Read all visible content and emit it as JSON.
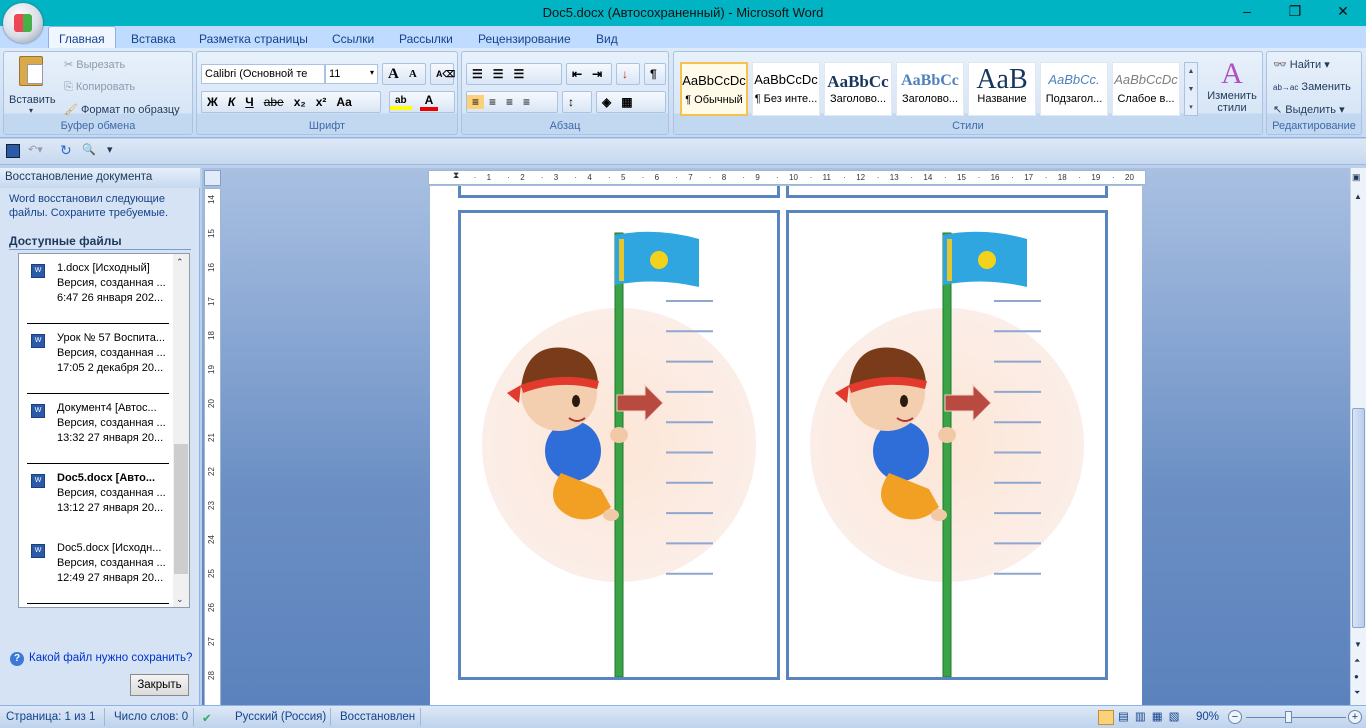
{
  "window": {
    "title": "Doc5.docx (Автосохраненный) - Microsoft Word",
    "min": "–",
    "max": "❐",
    "close": "✕"
  },
  "tabs": [
    "Главная",
    "Вставка",
    "Разметка страницы",
    "Ссылки",
    "Рассылки",
    "Рецензирование",
    "Вид"
  ],
  "clipboard": {
    "paste": "Вставить",
    "cut": "Вырезать",
    "copy": "Копировать",
    "format_painter": "Формат по образцу",
    "label": "Буфер обмена"
  },
  "font": {
    "name": "Calibri (Основной те",
    "size": "11",
    "label": "Шрифт",
    "bold": "Ж",
    "italic": "К",
    "underline": "Ч",
    "strike": "abe",
    "sub": "x₂",
    "sup": "x²",
    "case": "Aa",
    "grow": "A",
    "shrink": "A"
  },
  "paragraph": {
    "label": "Абзац",
    "pilcrow": "¶"
  },
  "styles": {
    "label": "Стили",
    "items": [
      {
        "sample": "AaBbCcDc",
        "name": "¶ Обычный"
      },
      {
        "sample": "AaBbCcDc",
        "name": "¶ Без инте..."
      },
      {
        "sample": "AaBbCc",
        "name": "Заголово..."
      },
      {
        "sample": "AaBbCc",
        "name": "Заголово..."
      },
      {
        "sample": "AaB",
        "name": "Название"
      },
      {
        "sample": "AaBbCc.",
        "name": "Подзагол..."
      },
      {
        "sample": "AaBbCcDc",
        "name": "Слабое в..."
      }
    ],
    "change": "Изменить стили"
  },
  "editing": {
    "label": "Редактирование",
    "find": "Найти",
    "replace": "Заменить",
    "select": "Выделить"
  },
  "recovery": {
    "title": "Восстановление документа",
    "message": "Word восстановил следующие файлы.  Сохраните требуемые.",
    "heading": "Доступные файлы",
    "files": [
      {
        "name": "1.docx  [Исходный]",
        "line2": "Версия, созданная ...",
        "line3": "6:47 26 января 202...",
        "bold": false
      },
      {
        "name": "Урок № 57 Воспита...",
        "line2": "Версия, созданная ...",
        "line3": "17:05 2 декабря 20...",
        "bold": false
      },
      {
        "name": "Документ4  [Автос...",
        "line2": "Версия, созданная ...",
        "line3": "13:32 27 января 20...",
        "bold": false
      },
      {
        "name": "Doc5.docx  [Авто...",
        "line2": "Версия, созданная ...",
        "line3": "13:12 27 января 20...",
        "bold": true
      },
      {
        "name": "Doc5.docx  [Исходн...",
        "line2": "Версия, созданная ...",
        "line3": "12:49 27 января 20...",
        "bold": false
      }
    ],
    "help": "Какой файл нужно сохранить?",
    "close": "Закрыть"
  },
  "status": {
    "page": "Страница: 1 из 1",
    "words": "Число слов: 0",
    "language": "Русский (Россия)",
    "state": "Восстановлен",
    "zoom": "90%"
  },
  "colors": {
    "accent": "#5885c0",
    "flag": "#2fa6e0",
    "pole": "#3aa345",
    "arrow": "#b84a3f"
  }
}
